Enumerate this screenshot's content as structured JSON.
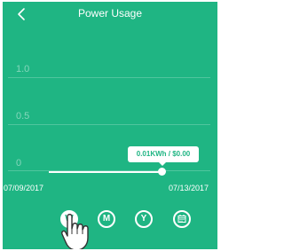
{
  "header": {
    "title": "Power Usage"
  },
  "chart_data": {
    "type": "line",
    "title": "",
    "xlabel": "",
    "ylabel": "",
    "ylim": [
      0,
      1.0
    ],
    "y_tick_labels": [
      "1.0",
      "0.5",
      "0"
    ],
    "x_tick_labels": [
      "07/09/2017",
      "07/13/2017"
    ],
    "series": [
      {
        "x": [
          "07/09/2017",
          "07/13/2017"
        ],
        "values": [
          0.01,
          0.01
        ]
      }
    ],
    "grid": true,
    "annotation": "0.01KWh / $0.00"
  },
  "period_buttons": [
    {
      "label": "W",
      "selected": true
    },
    {
      "label": "M",
      "selected": false
    },
    {
      "label": "Y",
      "selected": false
    }
  ],
  "icons": {
    "back": "back-arrow-icon",
    "calendar": "calendar-icon",
    "pointer": "pointing-hand-icon"
  },
  "colors": {
    "background": "#1fb583",
    "foreground": "#ffffff"
  }
}
